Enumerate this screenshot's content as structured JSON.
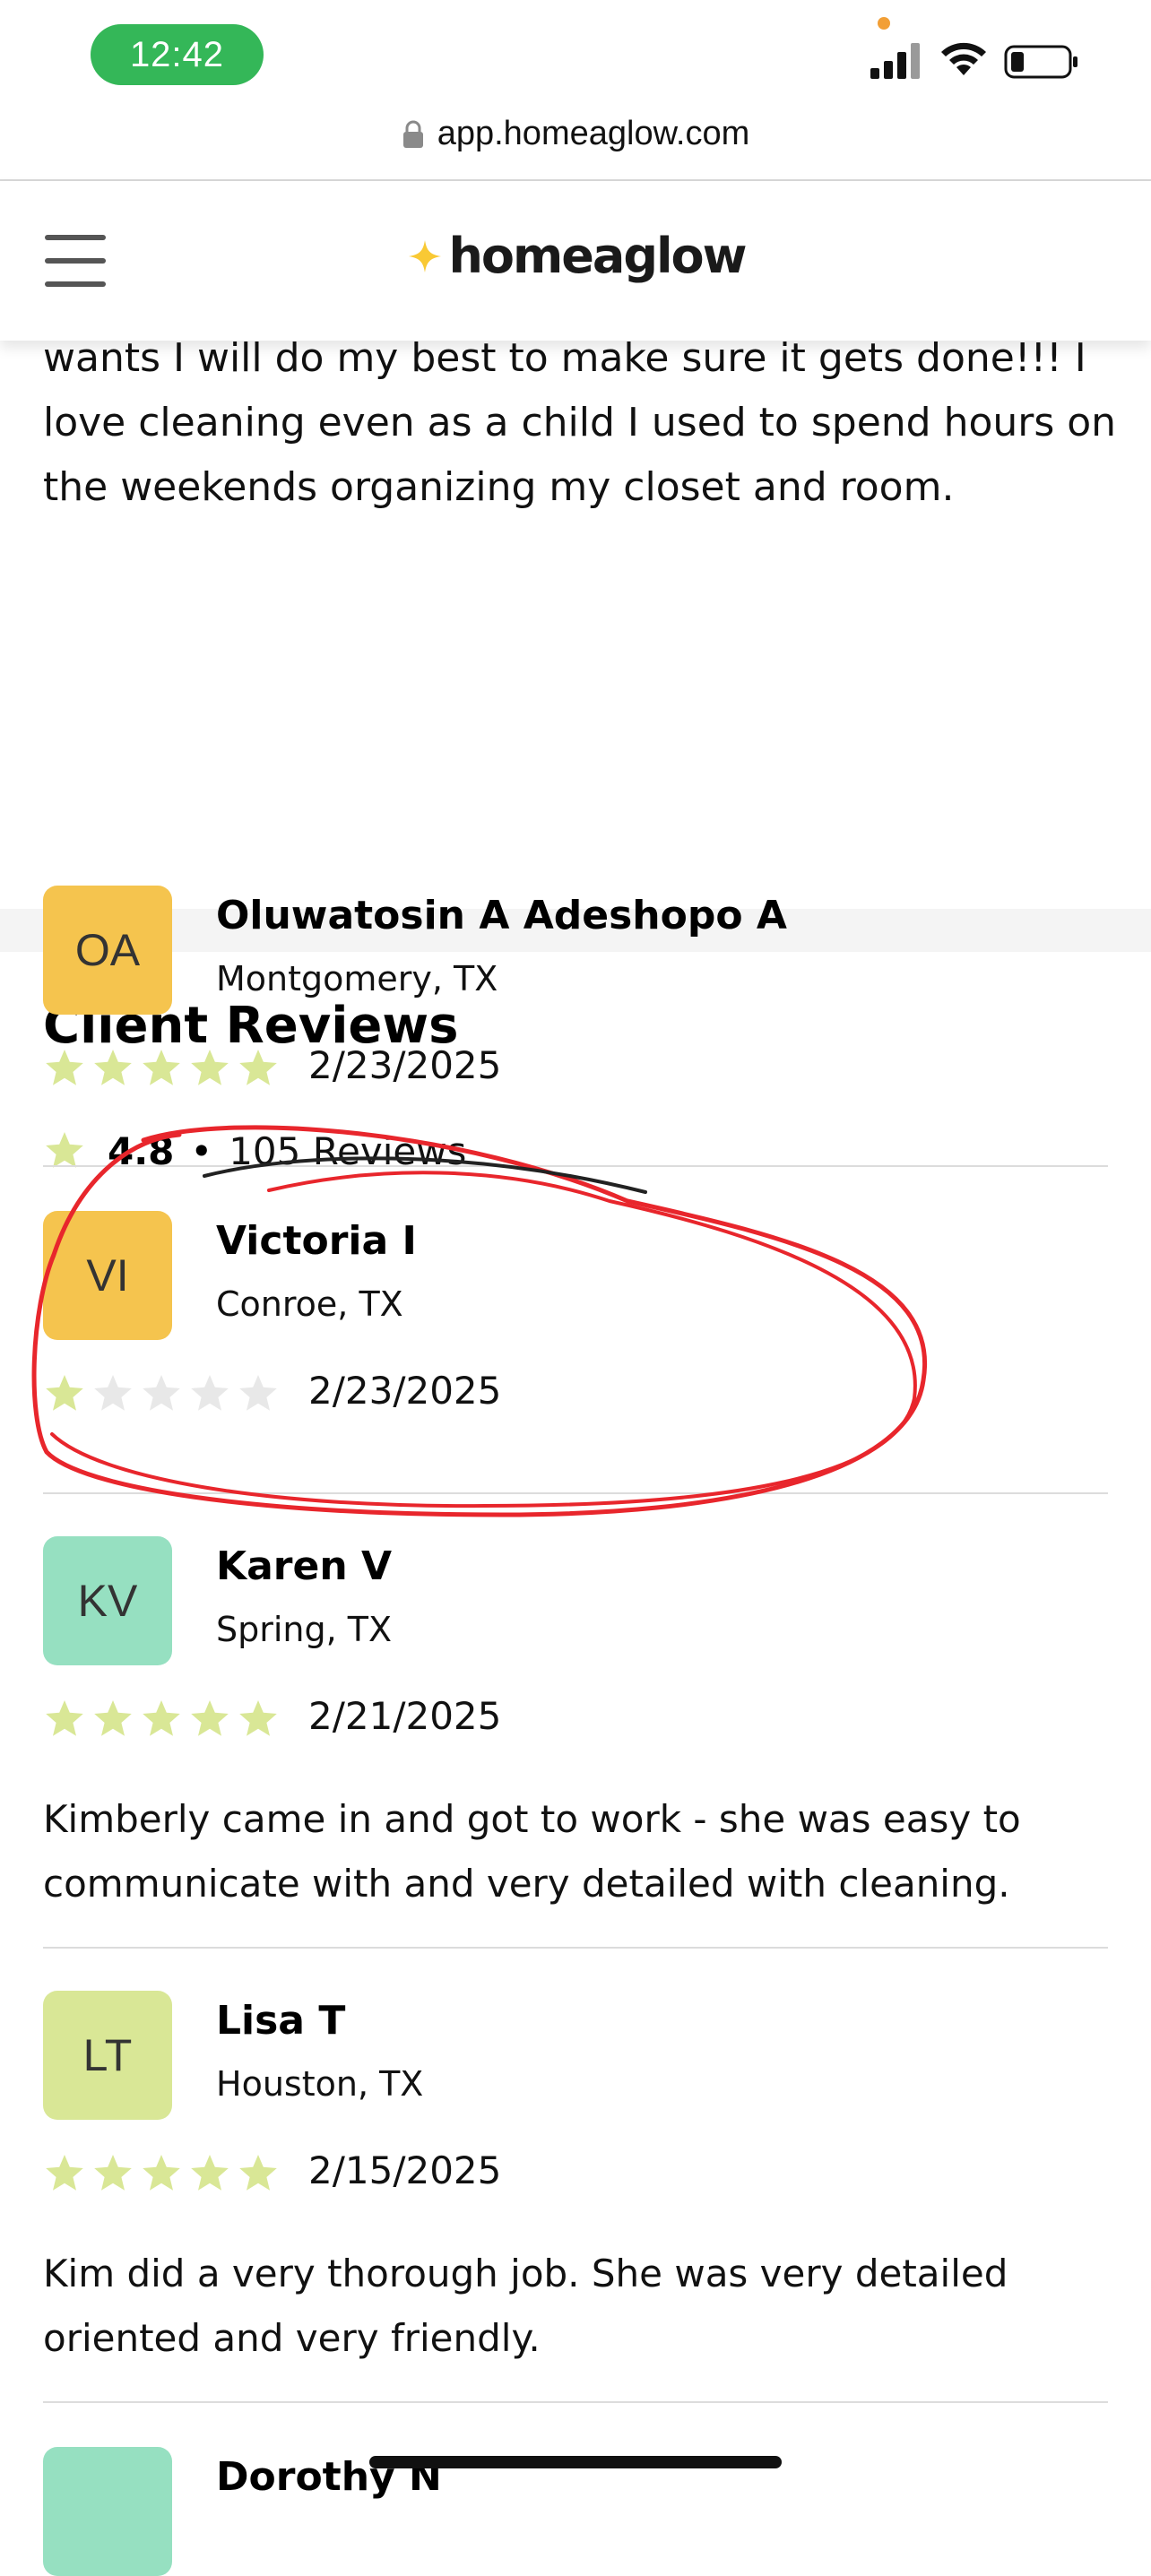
{
  "status_bar": {
    "time": "12:42"
  },
  "url_bar": {
    "url": "app.homeaglow.com"
  },
  "header": {
    "logo_text": "homeaglow"
  },
  "bio": {
    "text": "wants I will do my best to make sure it gets done!!! I love cleaning even as a child I used to spend hours on the weekends organizing my closet and room."
  },
  "reviews_section": {
    "title": "Client Reviews",
    "rating": "4.8",
    "separator": "•",
    "count_label": "105 Reviews"
  },
  "reviews": [
    {
      "initials": "OA",
      "avatar_color": "#f5c44e",
      "name": "Oluwatosin A Adeshopo A",
      "location": "Montgomery, TX",
      "stars": 5,
      "date": "2/23/2025",
      "text": ""
    },
    {
      "initials": "VI",
      "avatar_color": "#f5c44e",
      "name": "Victoria I",
      "location": "Conroe, TX",
      "stars": 1,
      "date": "2/23/2025",
      "text": ""
    },
    {
      "initials": "KV",
      "avatar_color": "#96e0c1",
      "name": "Karen V",
      "location": "Spring, TX",
      "stars": 5,
      "date": "2/21/2025",
      "text": "Kimberly came in and got to work - she was easy to communicate with and very detailed with cleaning."
    },
    {
      "initials": "LT",
      "avatar_color": "#d9e796",
      "name": "Lisa T",
      "location": "Houston, TX",
      "stars": 5,
      "date": "2/15/2025",
      "text": "Kim did a very thorough job. She was very detailed oriented and very friendly."
    },
    {
      "initials": "",
      "avatar_color": "#96e0c1",
      "name": "Dorothy N",
      "location": "",
      "stars": 0,
      "date": "",
      "text": ""
    }
  ],
  "colors": {
    "star_filled": "#d9e796",
    "star_empty": "#e8e8e8",
    "logo_spark": "#f9c934",
    "annotation": "#e8262c",
    "status_green": "#34b758"
  }
}
